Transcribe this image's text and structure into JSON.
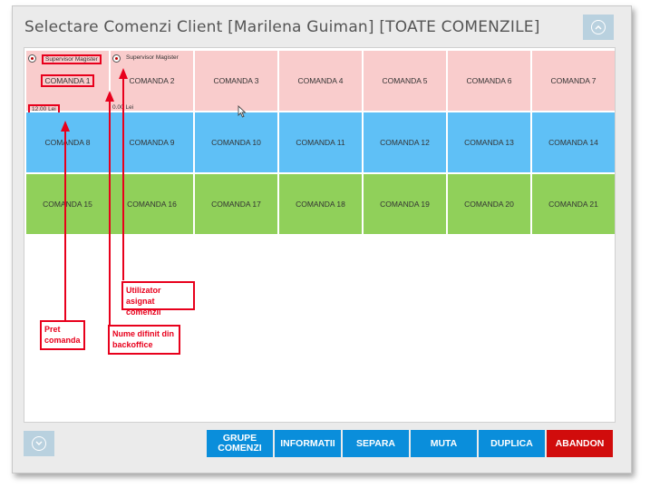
{
  "window": {
    "title": "Selectare Comenzi Client [Marilena Guiman] [TOATE COMENZILE]",
    "scroll_up_icon": "chevron-up-circle-icon",
    "scroll_down_icon": "chevron-down-circle-icon"
  },
  "orders": [
    {
      "label": "COMANDA 1",
      "user": "Supervisor Magister",
      "price": "12.00 Lei",
      "color": "pink"
    },
    {
      "label": "COMANDA 2",
      "user": "Supervisor Magister",
      "price": "0.00 Lei",
      "color": "pink"
    },
    {
      "label": "COMANDA 3",
      "color": "pink"
    },
    {
      "label": "COMANDA 4",
      "color": "pink"
    },
    {
      "label": "COMANDA 5",
      "color": "pink"
    },
    {
      "label": "COMANDA 6",
      "color": "pink"
    },
    {
      "label": "COMANDA 7",
      "color": "pink"
    },
    {
      "label": "COMANDA 8",
      "color": "blue"
    },
    {
      "label": "COMANDA 9",
      "color": "blue"
    },
    {
      "label": "COMANDA 10",
      "color": "blue"
    },
    {
      "label": "COMANDA 11",
      "color": "blue"
    },
    {
      "label": "COMANDA 12",
      "color": "blue"
    },
    {
      "label": "COMANDA 13",
      "color": "blue"
    },
    {
      "label": "COMANDA 14",
      "color": "blue"
    },
    {
      "label": "COMANDA 15",
      "color": "green"
    },
    {
      "label": "COMANDA 16",
      "color": "green"
    },
    {
      "label": "COMANDA 17",
      "color": "green"
    },
    {
      "label": "COMANDA 18",
      "color": "green"
    },
    {
      "label": "COMANDA 19",
      "color": "green"
    },
    {
      "label": "COMANDA 20",
      "color": "green"
    },
    {
      "label": "COMANDA 21",
      "color": "green"
    }
  ],
  "annotations": {
    "user_assigned": "Utilizator asignat comenzii",
    "name_defined": "Nume difinit din backoffice",
    "price": "Pret comanda"
  },
  "footer": {
    "grupe_comenzi": "GRUPE COMENZI",
    "informatii": "INFORMATII",
    "separa": "SEPARA",
    "muta": "MUTA",
    "duplica": "DUPLICA",
    "abandon": "ABANDON"
  },
  "colors": {
    "pink": "#f9cccc",
    "blue": "#5fc0f6",
    "green": "#90d05a",
    "action_button": "#0a8edb",
    "abandon_button": "#d10c0c",
    "annotation": "#e8001c"
  }
}
